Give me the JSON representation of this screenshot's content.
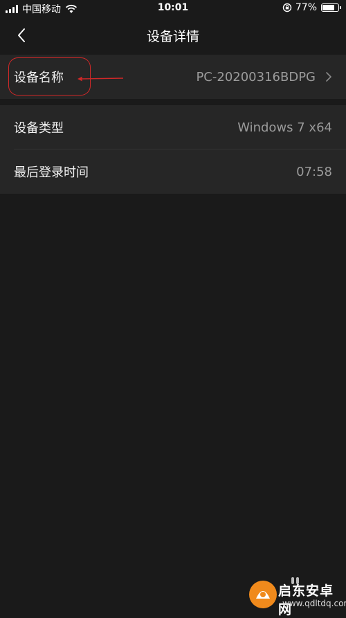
{
  "status_bar": {
    "carrier": "中国移动",
    "time": "10:01",
    "battery_percent": "77%",
    "battery_level": 0.77
  },
  "nav": {
    "title": "设备详情"
  },
  "rows": [
    {
      "label": "设备名称",
      "value": "PC-20200316BDPG"
    },
    {
      "label": "设备类型",
      "value": "Windows 7 x64"
    },
    {
      "label": "最后登录时间",
      "value": "07:58"
    }
  ],
  "colors": {
    "background": "#1a1a1a",
    "row_background": "#262626",
    "annotation": "#d12828",
    "watermark_orange": "#f08a1c"
  },
  "watermark": {
    "title": "启东安卓网",
    "url": "www.qdltdq.com"
  }
}
